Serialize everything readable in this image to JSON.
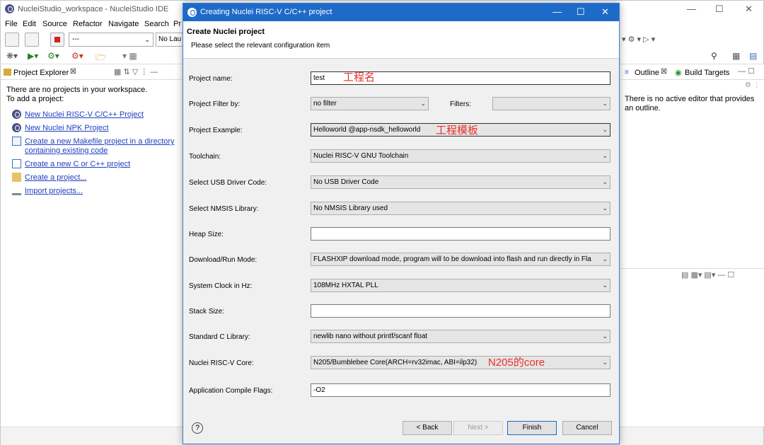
{
  "ide": {
    "title": "NucleiStudio_workspace - NucleiStudio IDE",
    "menus": [
      "File",
      "Edit",
      "Source",
      "Refactor",
      "Navigate",
      "Search",
      "Pr"
    ],
    "toolbar": {
      "config_select": "---",
      "launch_select": "No Lau"
    },
    "explorer": {
      "tab_label": "Project Explorer",
      "empty_line1": "There are no projects in your workspace.",
      "empty_line2": "To add a project:",
      "links": [
        "New Nuclei RISC-V C/C++ Project",
        "New Nuclei NPK Project",
        "Create a new Makefile project in a directory",
        "containing existing code",
        "Create a new C or C++ project",
        "Create a project...",
        "Import projects..."
      ]
    },
    "outline": {
      "tab_outline": "Outline",
      "tab_build": "Build Targets",
      "message": "There is no active editor that provides an outline."
    }
  },
  "dialog": {
    "title": "Creating Nuclei RISC-V C/C++ project",
    "heading": "Create Nuclei project",
    "subheading": "Please select the relevant configuration item",
    "fields": {
      "project_name": {
        "label": "Project name:",
        "value": "test",
        "annotation": "工程名"
      },
      "project_filter": {
        "label": "Project Filter by:",
        "value": "no filter",
        "filters_label": "Filters:",
        "filters_value": ""
      },
      "project_example": {
        "label": "Project Example:",
        "value": "Helloworld  @app-nsdk_helloworld",
        "annotation": "工程模板"
      },
      "toolchain": {
        "label": "Toolchain:",
        "value": "Nuclei RISC-V GNU Toolchain"
      },
      "usb_driver": {
        "label": "Select USB Driver Code:",
        "value": "No USB Driver Code"
      },
      "nmsis": {
        "label": "Select NMSIS Library:",
        "value": "No NMSIS Library used"
      },
      "heap_size": {
        "label": "Heap Size:",
        "value": ""
      },
      "download_mode": {
        "label": "Download/Run Mode:",
        "value": "FLASHXIP download mode, program will to be download into flash and run directly in Fla"
      },
      "system_clock": {
        "label": "System Clock in Hz:",
        "value": "108MHz HXTAL PLL"
      },
      "stack_size": {
        "label": "Stack Size:",
        "value": ""
      },
      "stdc_lib": {
        "label": "Standard C Library:",
        "value": "newlib nano without printf/scanf float"
      },
      "core": {
        "label": "Nuclei RISC-V Core:",
        "value": "N205/Bumblebee Core(ARCH=rv32imac, ABI=ilp32)",
        "annotation": "N205的core"
      },
      "compile_flags": {
        "label": "Application Compile Flags:",
        "value": "-O2"
      }
    },
    "buttons": {
      "back": "< Back",
      "next": "Next >",
      "finish": "Finish",
      "cancel": "Cancel"
    }
  }
}
